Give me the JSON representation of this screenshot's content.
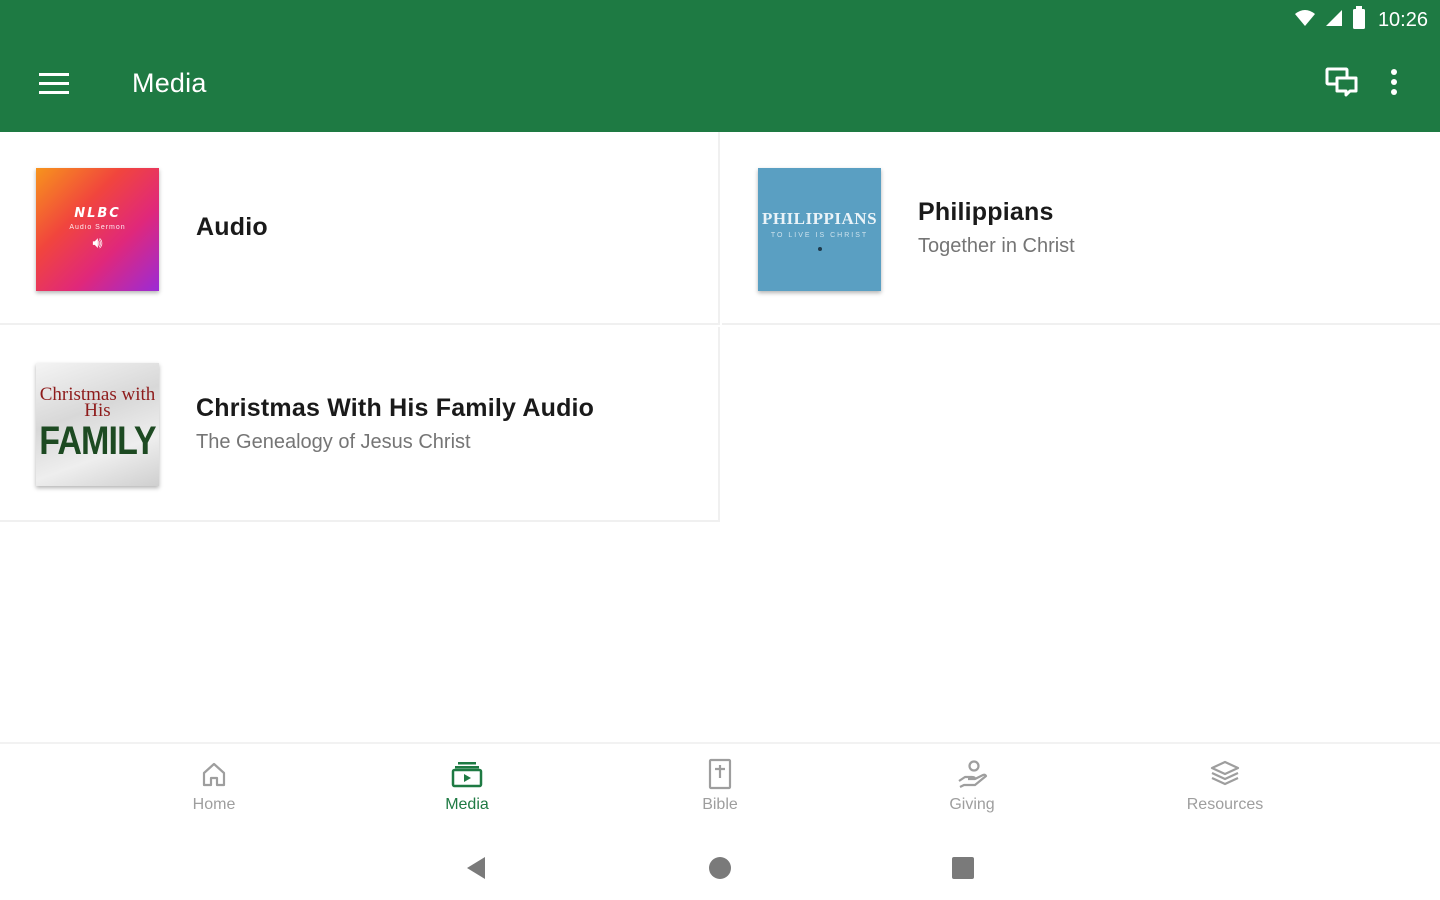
{
  "status_bar": {
    "time": "10:26"
  },
  "app_bar": {
    "title": "Media",
    "color": "#1e7a43"
  },
  "items": [
    {
      "title": "Audio",
      "subtitle": "",
      "thumbnail": {
        "line1": "NLBC",
        "line2": "Audio Sermon"
      }
    },
    {
      "title": "Philippians",
      "subtitle": "Together in Christ",
      "thumbnail": {
        "line1": "PHILIPPIANS",
        "line2": "TO LIVE IS CHRIST"
      }
    },
    {
      "title": "Christmas With His Family Audio",
      "subtitle": "The Genealogy of Jesus Christ",
      "thumbnail": {
        "line1": "Christmas with His",
        "line2": "FAMILY"
      }
    }
  ],
  "bottom_nav": [
    {
      "label": "Home",
      "icon": "home-icon",
      "active": false
    },
    {
      "label": "Media",
      "icon": "media-icon",
      "active": true
    },
    {
      "label": "Bible",
      "icon": "bible-icon",
      "active": false
    },
    {
      "label": "Giving",
      "icon": "giving-icon",
      "active": false
    },
    {
      "label": "Resources",
      "icon": "resources-icon",
      "active": false
    }
  ],
  "colors": {
    "primary": "#1e7a43",
    "inactive": "#9e9e9e"
  }
}
